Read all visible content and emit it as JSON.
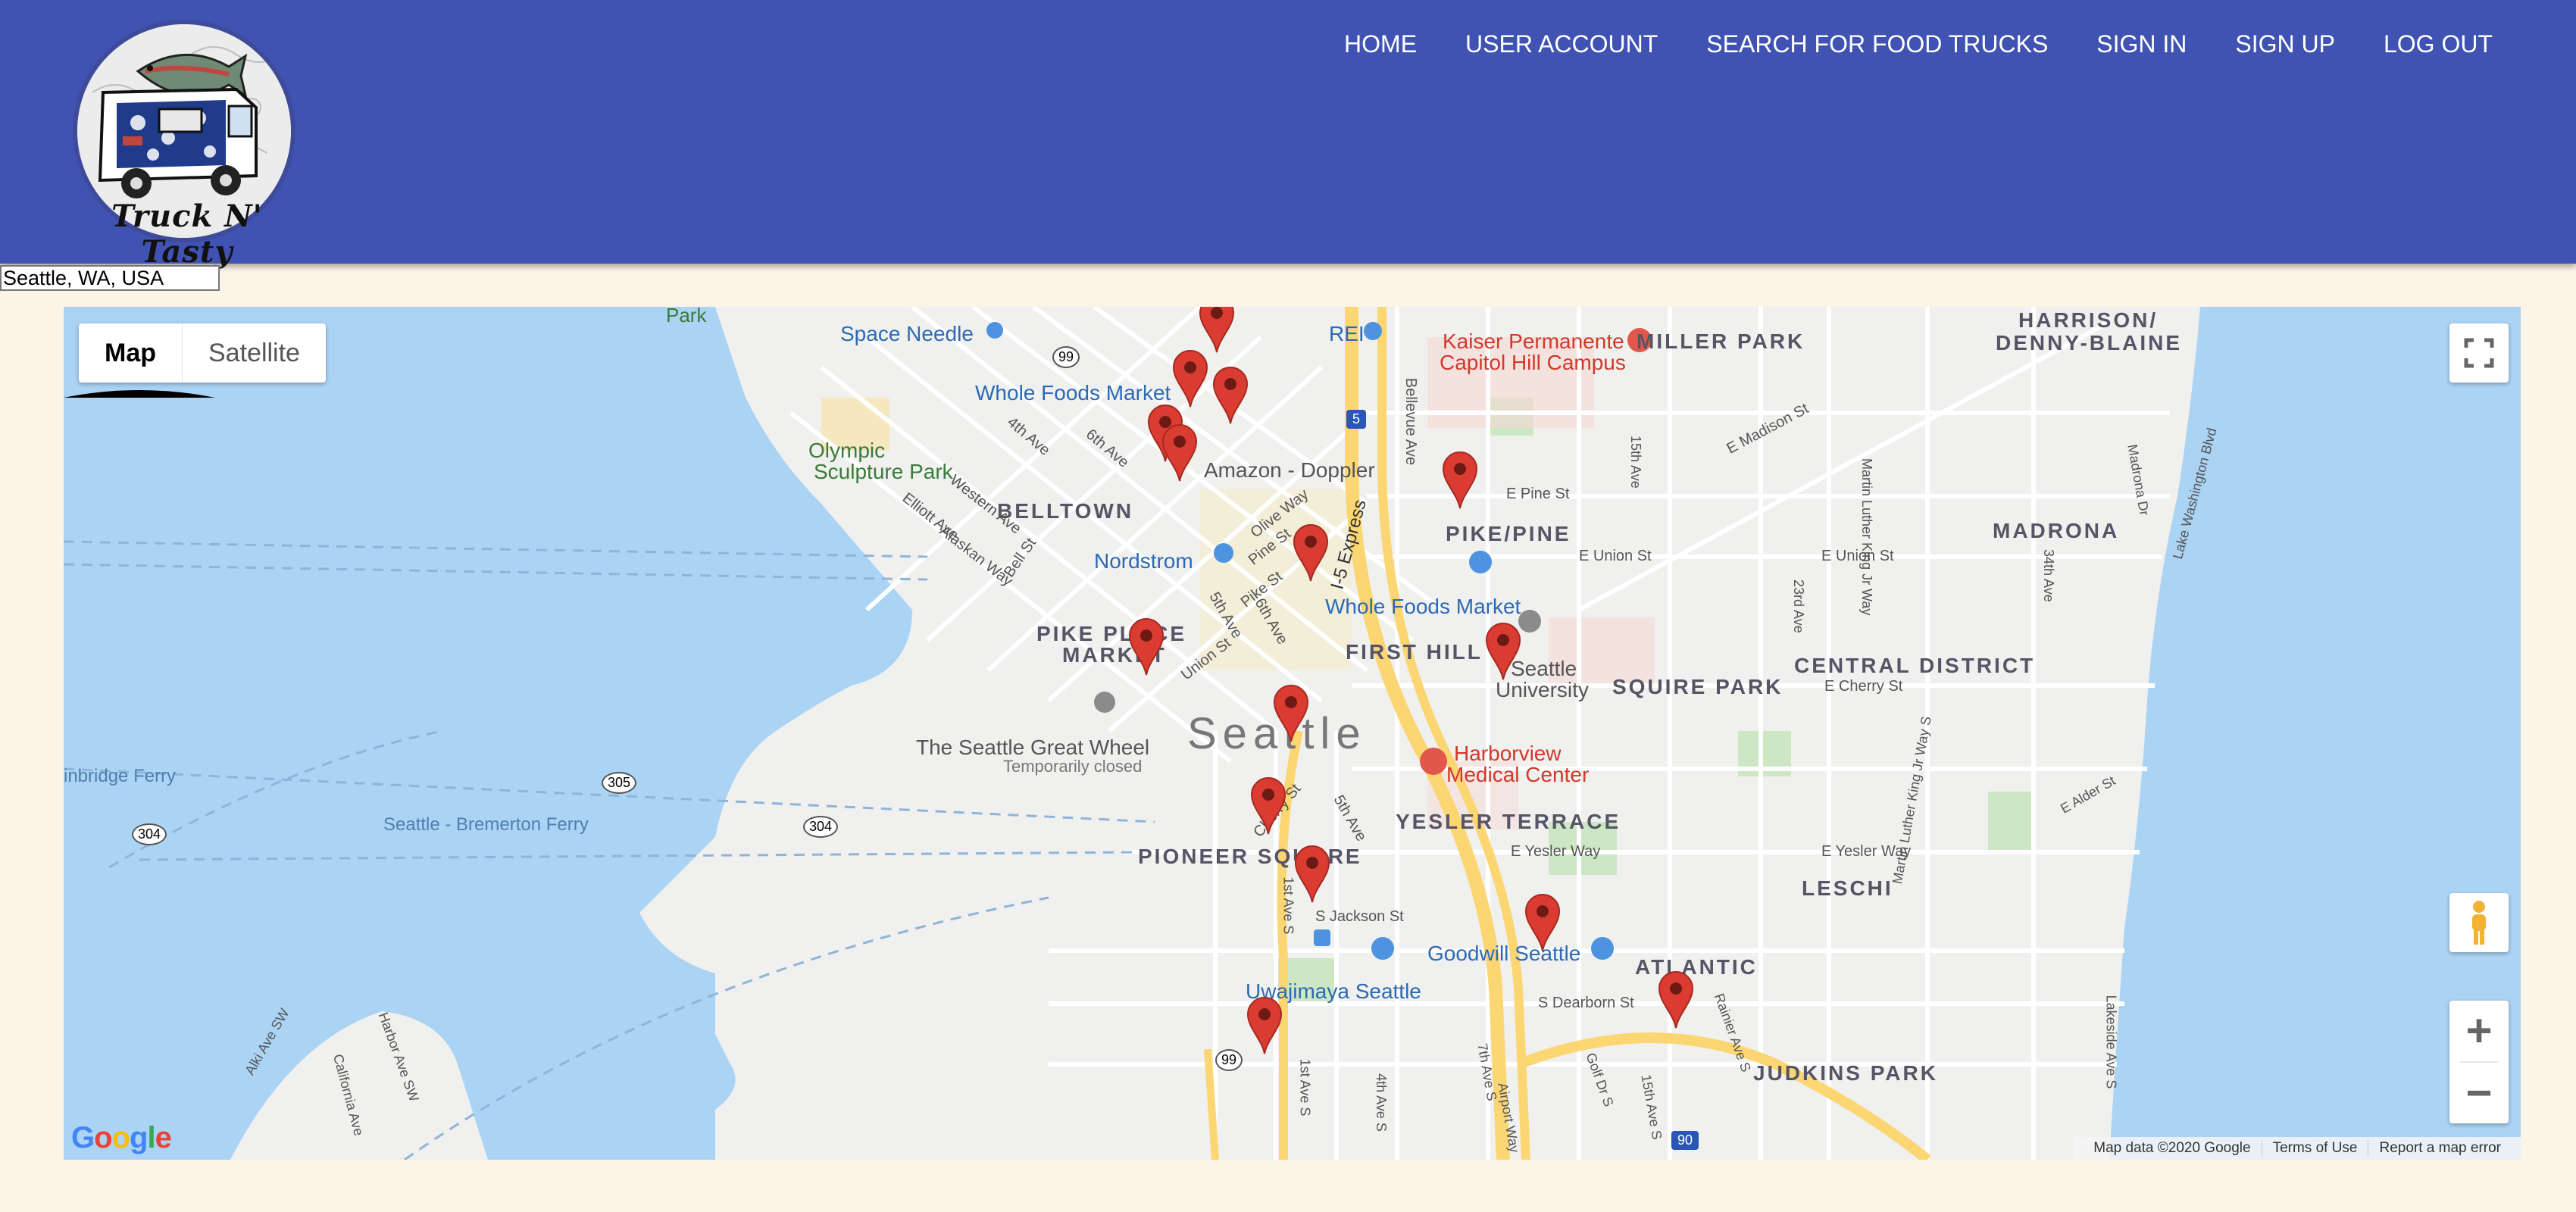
{
  "header": {
    "logo_text": "Truck N' Tasty",
    "nav": [
      "HOME",
      "USER ACCOUNT",
      "SEARCH FOR FOOD TRUCKS",
      "SIGN IN",
      "SIGN UP",
      "LOG OUT"
    ]
  },
  "search": {
    "value": "Seattle, WA, USA"
  },
  "map": {
    "type_controls": [
      "Map",
      "Satellite"
    ],
    "selected_type": "Map",
    "zoom_in": "+",
    "zoom_out": "−",
    "google_logo": "Google",
    "footer": [
      "Map data ©2020 Google",
      "Terms of Use",
      "Report a map error"
    ],
    "district_labels": {
      "belltown": "BELLTOWN",
      "pike_pine": "PIKE/PINE",
      "pike_place_1": "PIKE PLACE",
      "pike_place_2": "MARKET",
      "first_hill": "FIRST HILL",
      "squire_park": "SQUIRE PARK",
      "central_district": "CENTRAL DISTRICT",
      "yesler_terrace": "YESLER TERRACE",
      "pioneer_square": "PIONEER SQUARE",
      "leschi": "LESCHI",
      "atlantic": "ATLANTIC",
      "judkins_park": "JUDKINS PARK",
      "madrona": "MADRONA",
      "miller_park": "MILLER PARK",
      "harrison_1": "HARRISON/",
      "harrison_2": "DENNY-BLAINE"
    },
    "city_label": "Seattle",
    "poi_labels": {
      "space_needle": "Space Needle",
      "rei": "REI",
      "whole_foods_1": "Whole Foods Market",
      "whole_foods_2": "Whole Foods Market",
      "amazon": "Amazon - Doppler",
      "nordstrom": "Nordstrom",
      "kaiser_1": "Kaiser Permanente",
      "kaiser_2": "Capitol Hill Campus",
      "seattle_u_1": "Seattle",
      "seattle_u_2": "University",
      "olympic_1": "Olympic",
      "olympic_2": "Sculpture Park",
      "great_wheel": "The Seattle Great Wheel",
      "great_wheel_sub": "Temporarily closed",
      "harborview_1": "Harborview",
      "harborview_2": "Medical Center",
      "goodwill": "Goodwill Seattle",
      "uwajimaya": "Uwajimaya Seattle",
      "park": "Park"
    },
    "water_labels": {
      "bainbridge_ferry": "inbridge Ferry",
      "bremerton_ferry": "Seattle - Bremerton Ferry"
    },
    "street_labels": {
      "e_pine": "E Pine St",
      "e_union": "E Union St",
      "e_cherry": "E Cherry St",
      "e_yesler_1": "E Yesler Way",
      "e_yesler_2": "E Yesler Way",
      "s_jackson": "S Jackson St",
      "s_dearborn": "S Dearborn St",
      "e_madison": "E Madison St",
      "i5_express": "I-5 Express",
      "bellevue": "Bellevue Ave",
      "olive": "Olive Way",
      "pine": "Pine St",
      "pike": "Pike St",
      "union": "Union St",
      "fifth_1": "5th Ave",
      "sixth_1": "6th Ave",
      "fourth_1": "4th Ave",
      "sixth_2": "6th Ave",
      "cherry": "Cherry St",
      "fifth_2": "5th Ave",
      "first": "1st Ave S",
      "fourth_s": "4th Ave S",
      "seventh_s": "7th Ave S",
      "airport": "Airport Way",
      "golf": "Golf Dr S",
      "fifteenth_s": "15th Ave S",
      "rainier": "Rainier Ave S",
      "lakeside": "Lakeside Ave S",
      "alder": "E Alder St",
      "mlk": "Martin Luther King Jr Way",
      "mlk_s": "Martin Luther King Jr Way S",
      "twenty_third": "23rd Ave",
      "thirty_fourth": "34th Ave",
      "lake_wa": "Lake Washington Blvd",
      "madrona_dr": "Madrona Dr",
      "fifteenth": "15th Ave",
      "western": "Western Ave",
      "elliott": "Elliott Ave",
      "alaskan": "Alaskan Way",
      "bell": "Bell St",
      "alki": "Alki Ave SW",
      "harbor": "Harbor Ave SW",
      "california": "California Ave",
      "fourth_2": "4th Ave"
    },
    "route_shields": [
      "99",
      "5",
      "305",
      "304",
      "304",
      "99",
      "90"
    ],
    "markers": 14
  },
  "colors": {
    "header": "#4153b2",
    "page_bg": "#fdf4e8",
    "water": "#abd3f4",
    "land": "#f0f0ee",
    "marker": "#db3c31",
    "highway": "#fbd673"
  }
}
